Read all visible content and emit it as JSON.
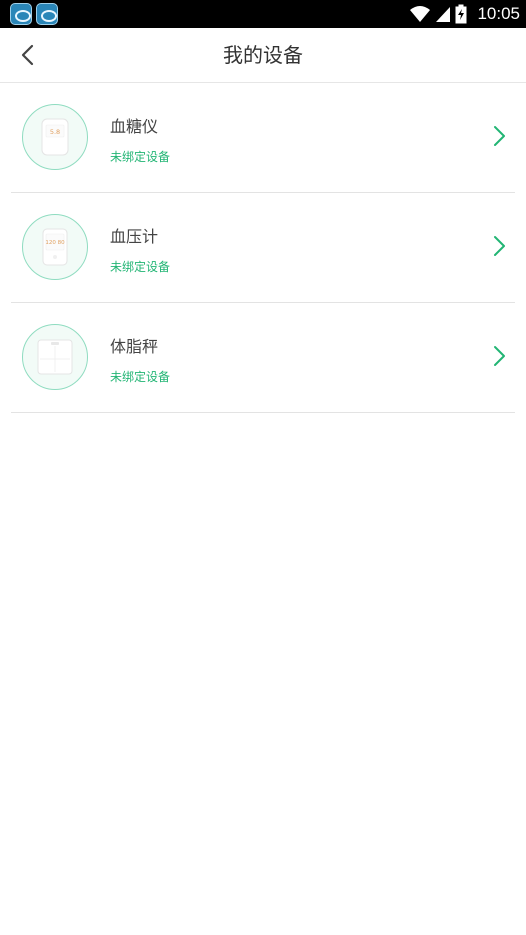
{
  "status_bar": {
    "time": "10:05",
    "icons": [
      "app-icon",
      "app-icon",
      "wifi-icon",
      "signal-icon",
      "battery-charging-icon"
    ]
  },
  "header": {
    "title": "我的设备",
    "back_icon": "chevron-left-icon"
  },
  "devices": [
    {
      "name": "血糖仪",
      "status": "未绑定设备",
      "icon": "glucose-meter-icon",
      "display": "5.8"
    },
    {
      "name": "血压计",
      "status": "未绑定设备",
      "icon": "blood-pressure-monitor-icon",
      "display": "120 80"
    },
    {
      "name": "体脂秤",
      "status": "未绑定设备",
      "icon": "body-fat-scale-icon"
    }
  ],
  "colors": {
    "accent": "#22b574",
    "circle_border": "#8fdcc0",
    "divider": "#e3e3e3",
    "status_bar": "#000000"
  }
}
